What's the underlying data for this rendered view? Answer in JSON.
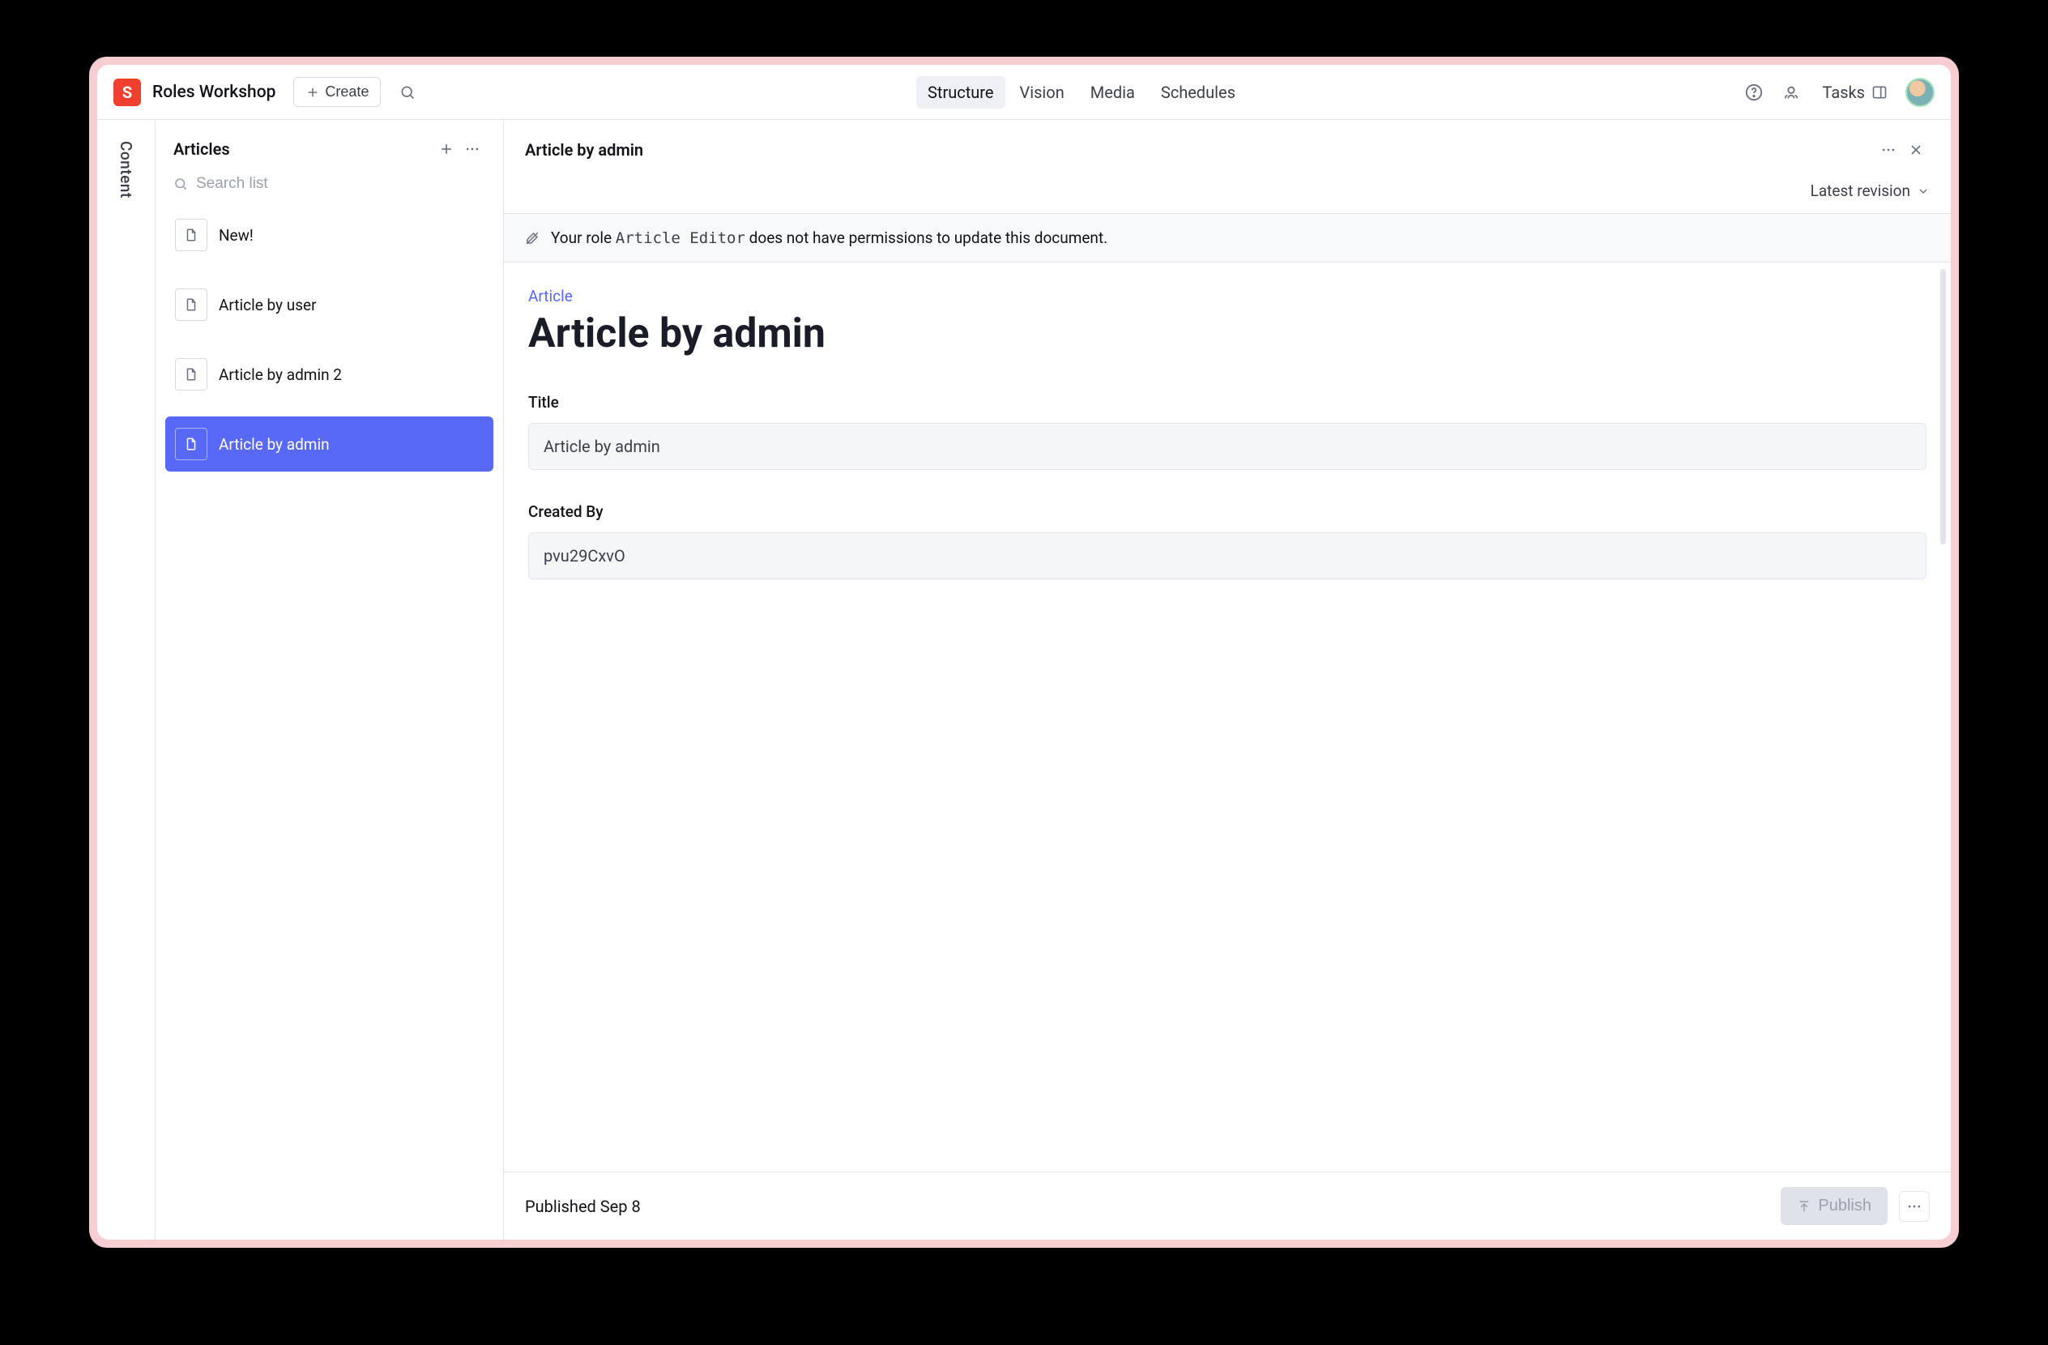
{
  "topbar": {
    "logo_letter": "S",
    "workspace_name": "Roles Workshop",
    "create_label": "Create",
    "nav": [
      {
        "label": "Structure",
        "active": true
      },
      {
        "label": "Vision",
        "active": false
      },
      {
        "label": "Media",
        "active": false
      },
      {
        "label": "Schedules",
        "active": false
      }
    ],
    "tasks_label": "Tasks"
  },
  "rail": {
    "label": "Content"
  },
  "list": {
    "title": "Articles",
    "search_placeholder": "Search list",
    "items": [
      {
        "label": "New!",
        "selected": false
      },
      {
        "label": "Article by user",
        "selected": false
      },
      {
        "label": "Article by admin 2",
        "selected": false
      },
      {
        "label": "Article by admin",
        "selected": true
      }
    ]
  },
  "doc": {
    "header_title": "Article by admin",
    "revision_label": "Latest revision",
    "banner": {
      "prefix": "Your role ",
      "role_code": "Article Editor",
      "suffix": " does not have permissions to update this document."
    },
    "schema_label": "Article",
    "title": "Article by admin",
    "fields": {
      "title_label": "Title",
      "title_value": "Article by admin",
      "createdby_label": "Created By",
      "createdby_value": "pvu29CxvO"
    },
    "footer": {
      "status": "Published Sep 8",
      "publish_label": "Publish"
    }
  }
}
